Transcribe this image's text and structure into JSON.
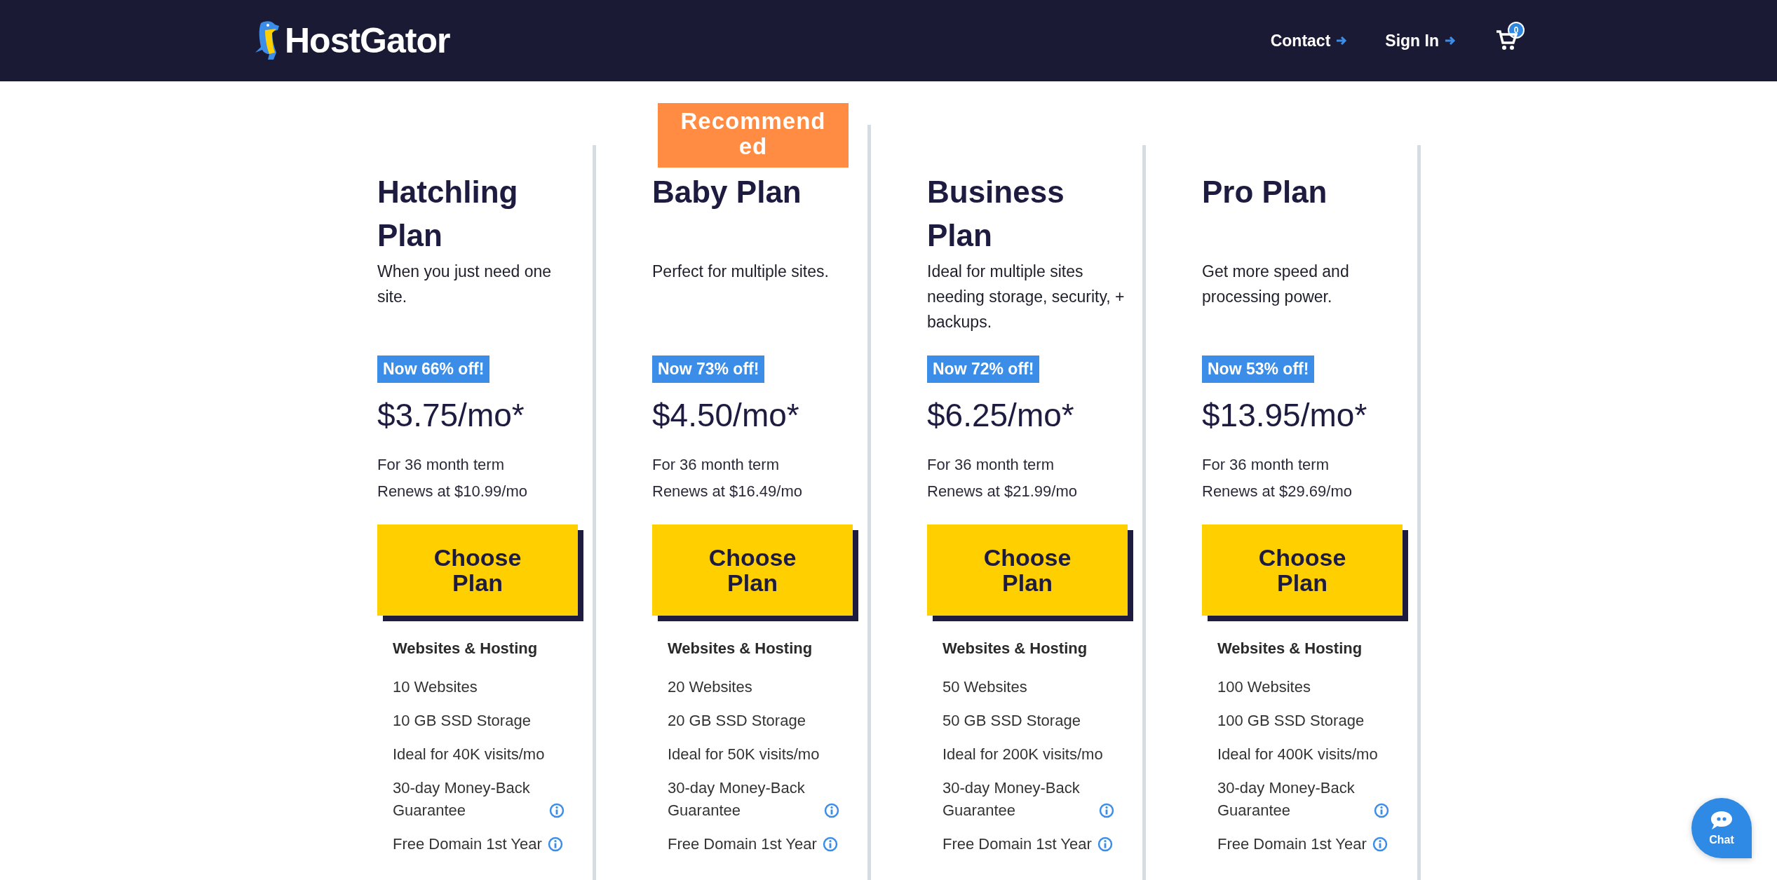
{
  "header": {
    "brand": "HostGator",
    "nav": [
      {
        "label": "Contact"
      },
      {
        "label": "Sign In"
      }
    ],
    "cart_count": "0"
  },
  "plans": [
    {
      "name": "Hatchling Plan",
      "description": "When you just need one site.",
      "discount": "Now 66% off!",
      "price": "$3.75/mo*",
      "term": "For 36 month term",
      "renewal": "Renews at $10.99/mo",
      "button": "Choose Plan",
      "features_title": "Websites & Hosting",
      "features": [
        {
          "text": "10 Websites",
          "info": false
        },
        {
          "text": "10 GB SSD Storage",
          "info": false
        },
        {
          "text": "Ideal for 40K visits/mo",
          "info": false
        },
        {
          "text": "30-day Money-Back Guarantee",
          "info": true
        },
        {
          "text": "Free Domain 1st Year",
          "info": true
        }
      ]
    },
    {
      "name": "Baby Plan",
      "ribbon": "Recommended",
      "description": "Perfect for multiple sites.",
      "discount": "Now 73% off!",
      "price": "$4.50/mo*",
      "term": "For 36 month term",
      "renewal": "Renews at $16.49/mo",
      "button": "Choose Plan",
      "features_title": "Websites & Hosting",
      "features": [
        {
          "text": "20 Websites",
          "info": false
        },
        {
          "text": "20 GB SSD Storage",
          "info": false
        },
        {
          "text": "Ideal for 50K visits/mo",
          "info": false
        },
        {
          "text": "30-day Money-Back Guarantee",
          "info": true
        },
        {
          "text": "Free Domain 1st Year",
          "info": true
        }
      ]
    },
    {
      "name": "Business Plan",
      "description": "Ideal for multiple sites needing storage, security, + backups.",
      "discount": "Now 72% off!",
      "price": "$6.25/mo*",
      "term": "For 36 month term",
      "renewal": "Renews at $21.99/mo",
      "button": "Choose Plan",
      "features_title": "Websites & Hosting",
      "features": [
        {
          "text": "50 Websites",
          "info": false
        },
        {
          "text": "50 GB SSD Storage",
          "info": false
        },
        {
          "text": "Ideal for 200K visits/mo",
          "info": false
        },
        {
          "text": "30-day Money-Back Guarantee",
          "info": true
        },
        {
          "text": "Free Domain 1st Year",
          "info": true
        }
      ]
    },
    {
      "name": "Pro Plan",
      "description": "Get more speed and processing power.",
      "discount": "Now 53% off!",
      "price": "$13.95/mo*",
      "term": "For 36 month term",
      "renewal": "Renews at $29.69/mo",
      "button": "Choose Plan",
      "features_title": "Websites & Hosting",
      "features": [
        {
          "text": "100 Websites",
          "info": false
        },
        {
          "text": "100 GB SSD Storage",
          "info": false
        },
        {
          "text": "Ideal for 400K visits/mo",
          "info": false
        },
        {
          "text": "30-day Money-Back Guarantee",
          "info": true
        },
        {
          "text": "Free Domain 1st Year",
          "info": true
        }
      ]
    }
  ],
  "chat": {
    "label": "Chat"
  }
}
